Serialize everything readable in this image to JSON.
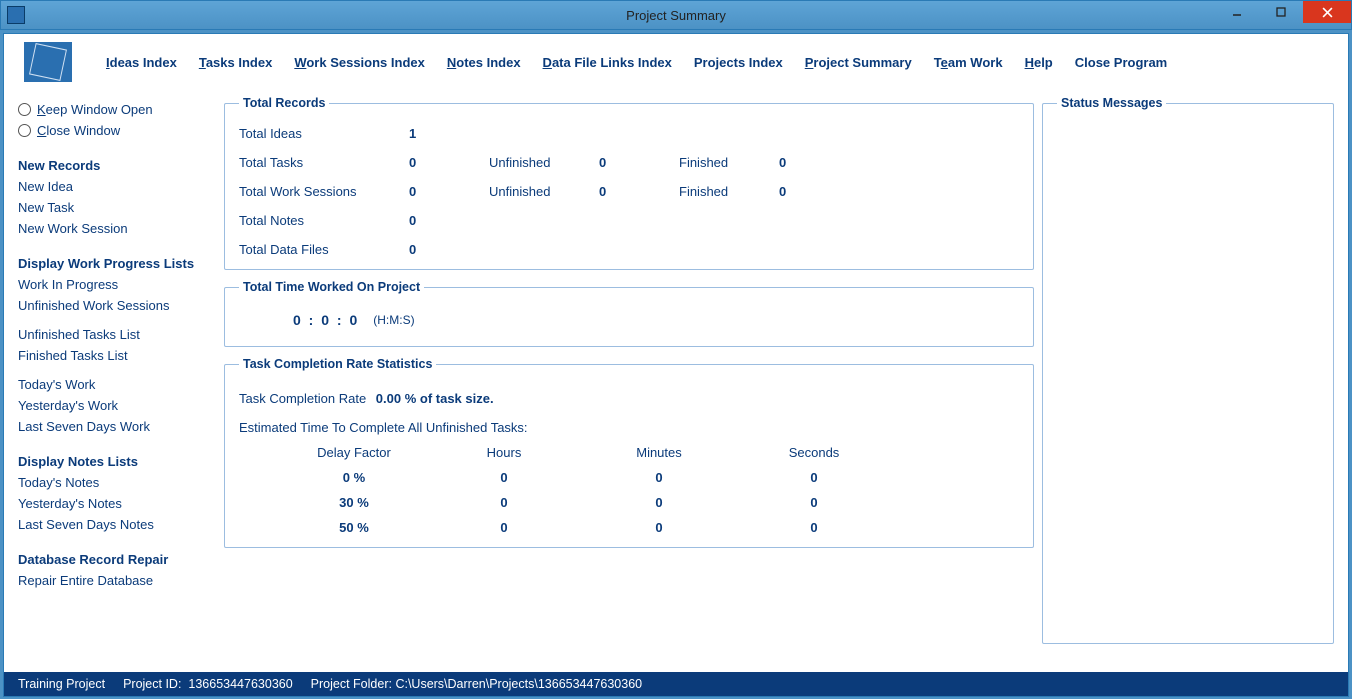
{
  "window": {
    "title": "Project Summary"
  },
  "menu": {
    "ideas": "Ideas Index",
    "tasks": "Tasks Index",
    "work": "Work Sessions Index",
    "notes": "Notes Index",
    "data": "Data File Links Index",
    "projects": "Projects Index",
    "summary": "Project Summary",
    "team": "Team Work",
    "help": "Help",
    "close": "Close Program"
  },
  "window_options": {
    "keep_open": "Keep Window Open",
    "close": "Close Window"
  },
  "sidebar": {
    "new_records": {
      "title": "New Records",
      "idea": "New Idea",
      "task": "New Task",
      "work": "New Work Session"
    },
    "progress": {
      "title": "Display Work Progress Lists",
      "wip": "Work In Progress",
      "unfinished_ws": "Unfinished Work Sessions",
      "unfinished_tasks": "Unfinished Tasks List",
      "finished_tasks": "Finished Tasks List",
      "today": "Today's Work",
      "yesterday": "Yesterday's Work",
      "last7": "Last Seven Days Work"
    },
    "notes_lists": {
      "title": "Display Notes Lists",
      "today": "Today's Notes",
      "yesterday": "Yesterday's Notes",
      "last7": "Last Seven Days Notes"
    },
    "repair": {
      "title": "Database Record Repair",
      "all": "Repair Entire Database"
    }
  },
  "records": {
    "legend": "Total Records",
    "ideas_label": "Total Ideas",
    "ideas_val": "1",
    "tasks_label": "Total Tasks",
    "tasks_val": "0",
    "tasks_unfinished_label": "Unfinished",
    "tasks_unfinished_val": "0",
    "tasks_finished_label": "Finished",
    "tasks_finished_val": "0",
    "ws_label": "Total Work Sessions",
    "ws_val": "0",
    "ws_unfinished_label": "Unfinished",
    "ws_unfinished_val": "0",
    "ws_finished_label": "Finished",
    "ws_finished_val": "0",
    "notes_label": "Total Notes",
    "notes_val": "0",
    "data_label": "Total Data Files",
    "data_val": "0"
  },
  "time": {
    "legend": "Total Time Worked On Project",
    "value": "0 :  0   :  0",
    "unit": "(H:M:S)"
  },
  "completion": {
    "legend": "Task Completion Rate Statistics",
    "rate_label": "Task Completion Rate",
    "rate_val": "0.00 % of task size.",
    "est_label": "Estimated Time To Complete All Unfinished Tasks:",
    "headers": {
      "delay": "Delay Factor",
      "hours": "Hours",
      "minutes": "Minutes",
      "seconds": "Seconds"
    },
    "rows": [
      {
        "delay": "0 %",
        "h": "0",
        "m": "0",
        "s": "0"
      },
      {
        "delay": "30 %",
        "h": "0",
        "m": "0",
        "s": "0"
      },
      {
        "delay": "50 %",
        "h": "0",
        "m": "0",
        "s": "0"
      }
    ]
  },
  "status_panel": {
    "legend": "Status Messages"
  },
  "statusbar": {
    "project": "Training Project",
    "id_label": "Project ID:",
    "id_val": "136653447630360",
    "folder_label": "Project Folder:",
    "folder_val": "C:\\Users\\Darren\\Projects\\136653447630360"
  }
}
